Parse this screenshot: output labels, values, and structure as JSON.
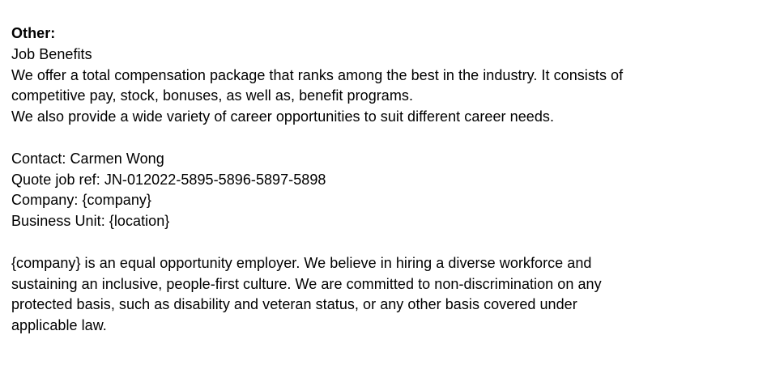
{
  "document": {
    "heading": "Other:",
    "benefits": {
      "title": "Job Benefits",
      "lines": [
        "We offer a total compensation package that ranks among the best in the industry. It consists of",
        "competitive pay, stock, bonuses, as well as, benefit programs.",
        "We also provide a wide variety of career opportunities to suit different career needs."
      ]
    },
    "contact": {
      "contact_line": "Contact: Carmen Wong",
      "job_ref_line": "Quote job ref: JN-012022-5895-5896-5897-5898",
      "company_line": "Company: {company}",
      "business_unit_line": "Business Unit: {location}"
    },
    "eeo": {
      "lines": [
        "{company} is an equal opportunity employer. We believe in hiring a diverse workforce and",
        "sustaining an inclusive, people-first culture. We are committed to non-discrimination on any",
        "protected basis, such as disability and veteran status, or any other basis covered under",
        "applicable law."
      ]
    }
  }
}
